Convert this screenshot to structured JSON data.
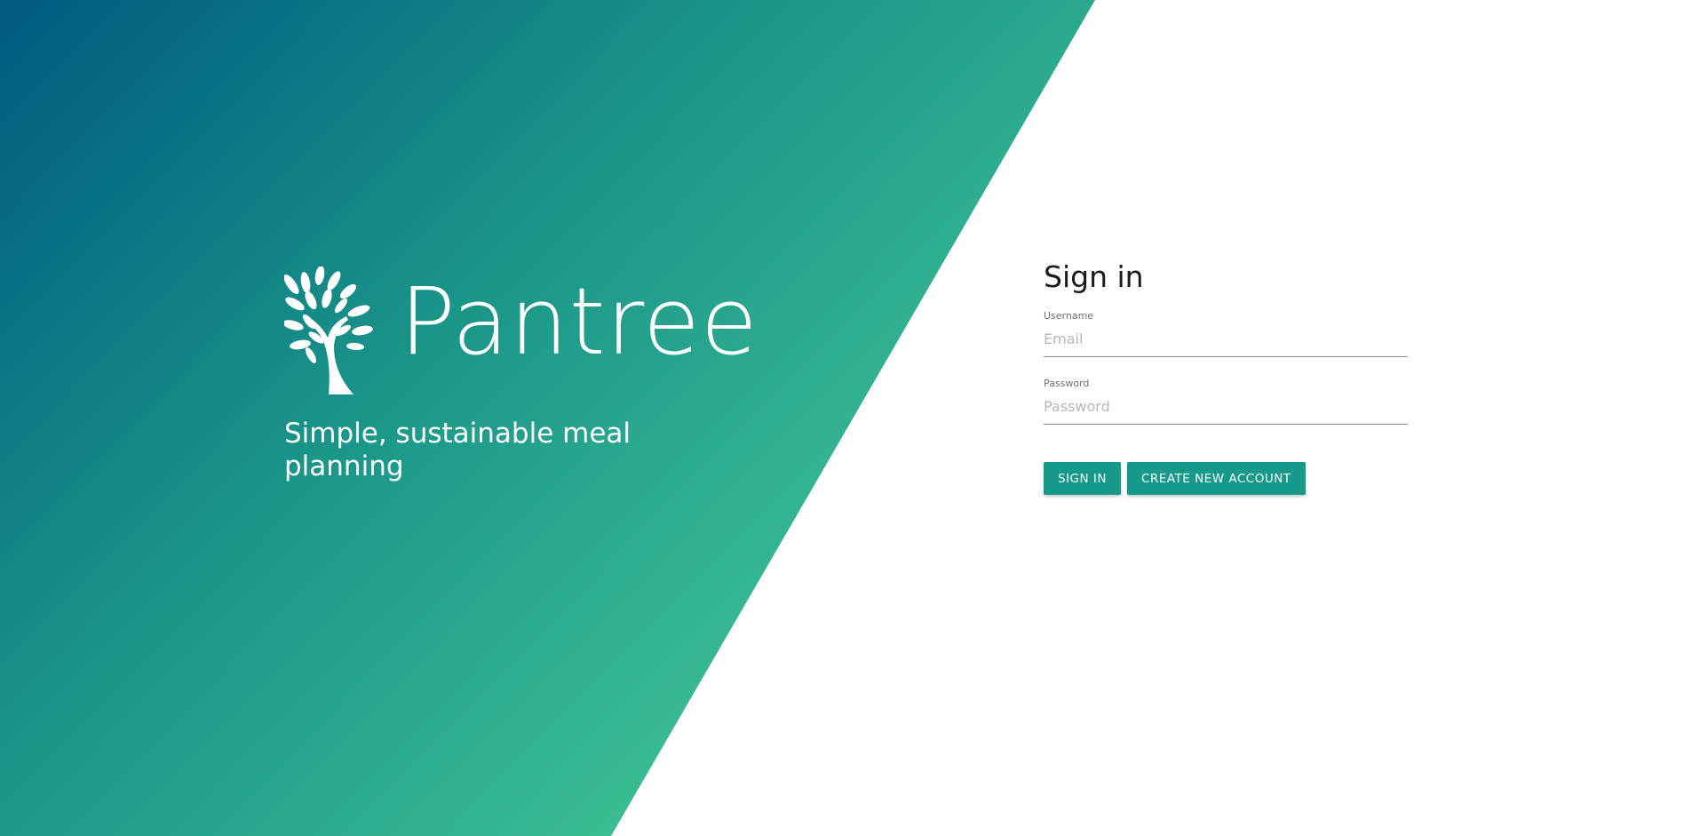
{
  "brand": {
    "name": "Pantree",
    "tagline": "Simple, sustainable meal planning",
    "logo_icon": "tree-icon"
  },
  "colors": {
    "gradient_start": "#005a80",
    "gradient_mid": "#1a9689",
    "gradient_end": "#48cc98",
    "primary_button": "#14998a",
    "text_light": "#ffffff",
    "text_dark": "#1a1a1a"
  },
  "signin": {
    "title": "Sign in",
    "username": {
      "label": "Username",
      "placeholder": "Email",
      "value": ""
    },
    "password": {
      "label": "Password",
      "placeholder": "Password",
      "value": ""
    },
    "buttons": {
      "sign_in": "SIGN IN",
      "create_account": "CREATE NEW ACCOUNT"
    }
  }
}
